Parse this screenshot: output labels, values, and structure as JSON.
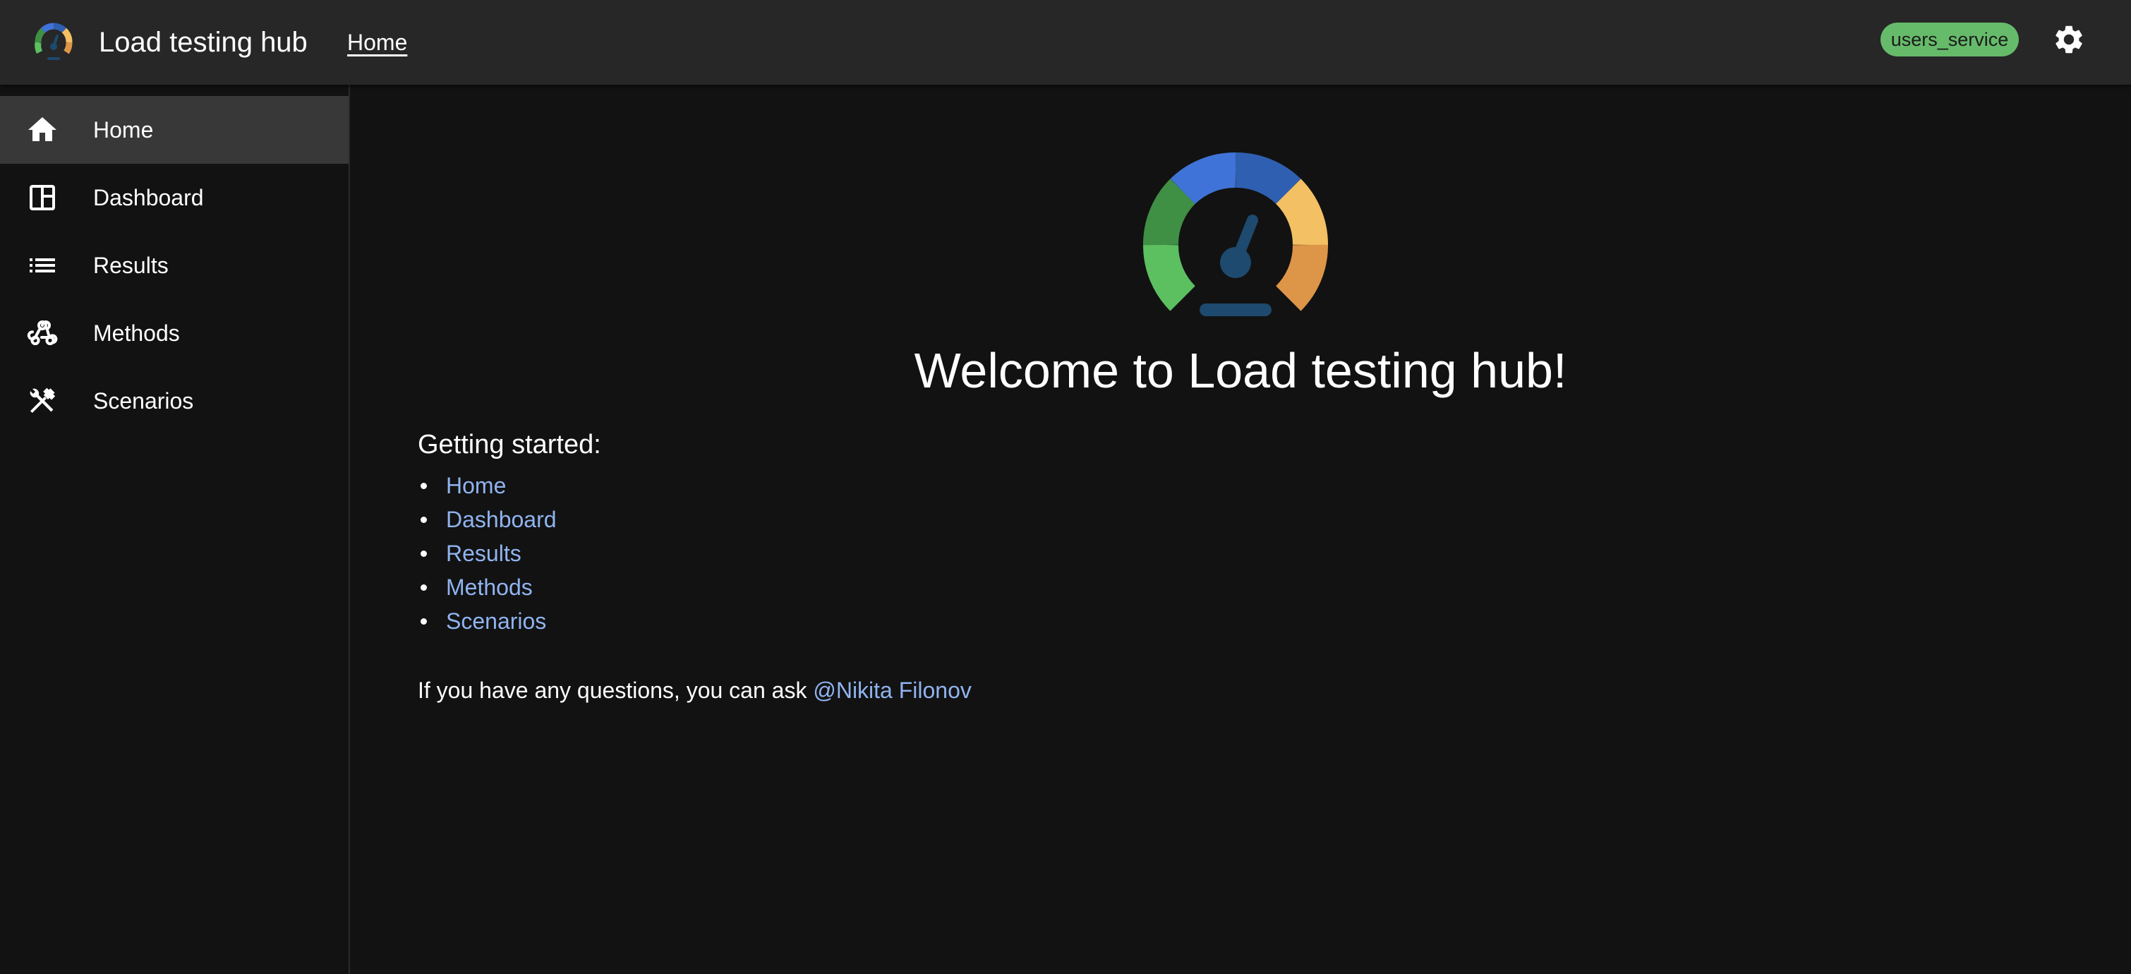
{
  "appbar": {
    "title": "Load testing hub",
    "breadcrumb": "Home",
    "service_chip": "users_service",
    "logo_icon": "speedometer-logo-icon",
    "settings_icon": "gear-icon"
  },
  "sidebar": {
    "items": [
      {
        "label": "Home",
        "icon": "home-icon",
        "active": true
      },
      {
        "label": "Dashboard",
        "icon": "dashboard-icon",
        "active": false
      },
      {
        "label": "Results",
        "icon": "list-icon",
        "active": false
      },
      {
        "label": "Methods",
        "icon": "webhook-icon",
        "active": false
      },
      {
        "label": "Scenarios",
        "icon": "tools-icon",
        "active": false
      }
    ]
  },
  "main": {
    "welcome": "Welcome to Load testing hub!",
    "getting_started_title": "Getting started:",
    "links": [
      "Home",
      "Dashboard",
      "Results",
      "Methods",
      "Scenarios"
    ],
    "question_text": "If you have any questions, you can ask ",
    "question_contact": "@Nikita Filonov"
  },
  "colors": {
    "appbar_bg": "#272727",
    "page_bg": "#121212",
    "active_item_bg": "#383838",
    "link": "#90b4f0",
    "chip_bg": "#66bb6a",
    "gauge_green": "#5cbf60",
    "gauge_dark_green": "#3f8f45",
    "gauge_blue": "#3f73d8",
    "gauge_dark_blue": "#2f5fb0",
    "gauge_yellow": "#f3c063",
    "gauge_orange": "#dd9548",
    "needle": "#1d4a6e"
  }
}
